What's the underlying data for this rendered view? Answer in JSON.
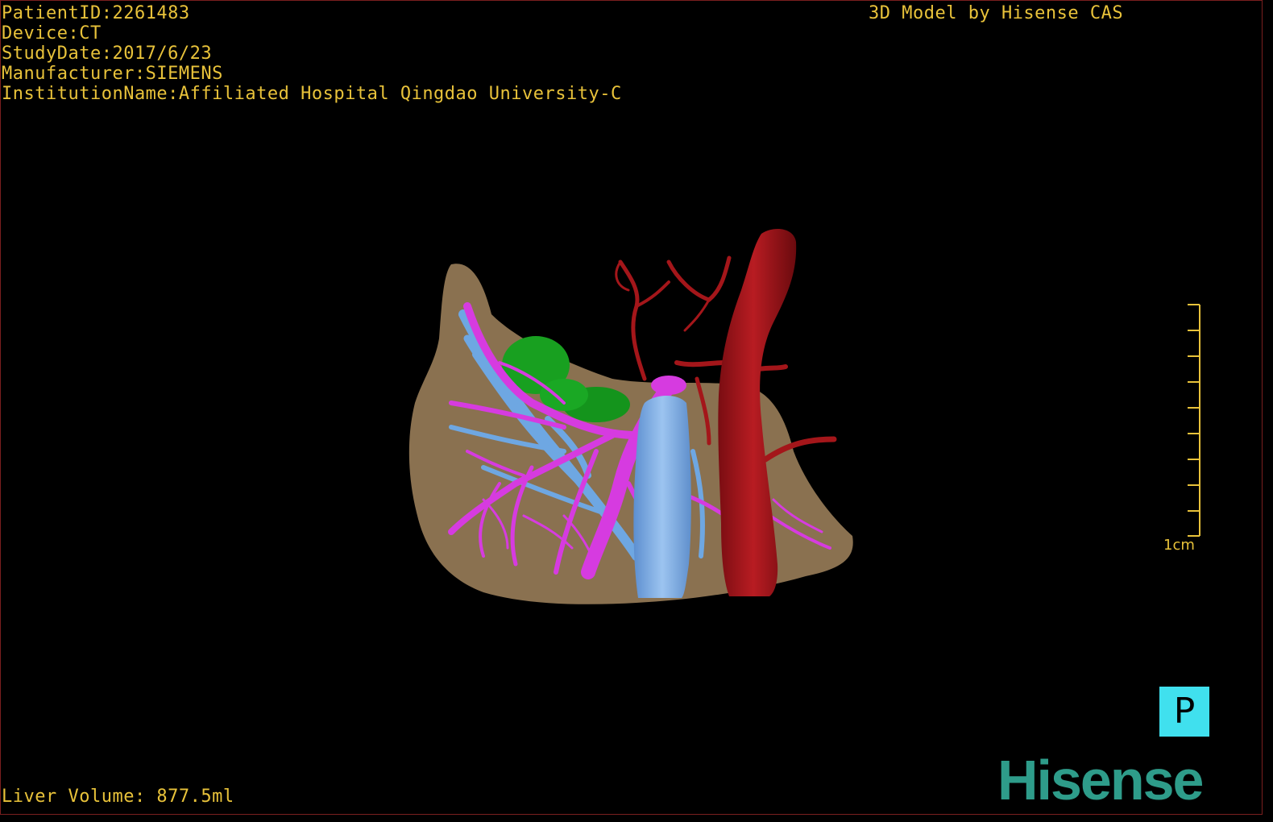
{
  "header": {
    "patient_id": "PatientID:2261483",
    "device": "Device:CT",
    "study_date": "StudyDate:2017/6/23",
    "manufacturer": "Manufacturer:SIEMENS",
    "institution": "InstitutionName:Affiliated Hospital Qingdao University-C",
    "credit": "3D Model by Hisense CAS"
  },
  "footer": {
    "liver_volume": "Liver Volume: 877.5ml"
  },
  "scale": {
    "label": "1cm"
  },
  "orientation": {
    "label": "P"
  },
  "brand": {
    "logo": "Hisense"
  },
  "colors": {
    "text": "#e8c23a",
    "liver": "#8a7150",
    "portal_vein": "#d63be0",
    "hepatic_vein": "#6ea7e2",
    "tumor": "#18a020",
    "aorta": "#a4161a",
    "orientation_box": "#40e0ee",
    "logo": "#2e9c8a"
  }
}
